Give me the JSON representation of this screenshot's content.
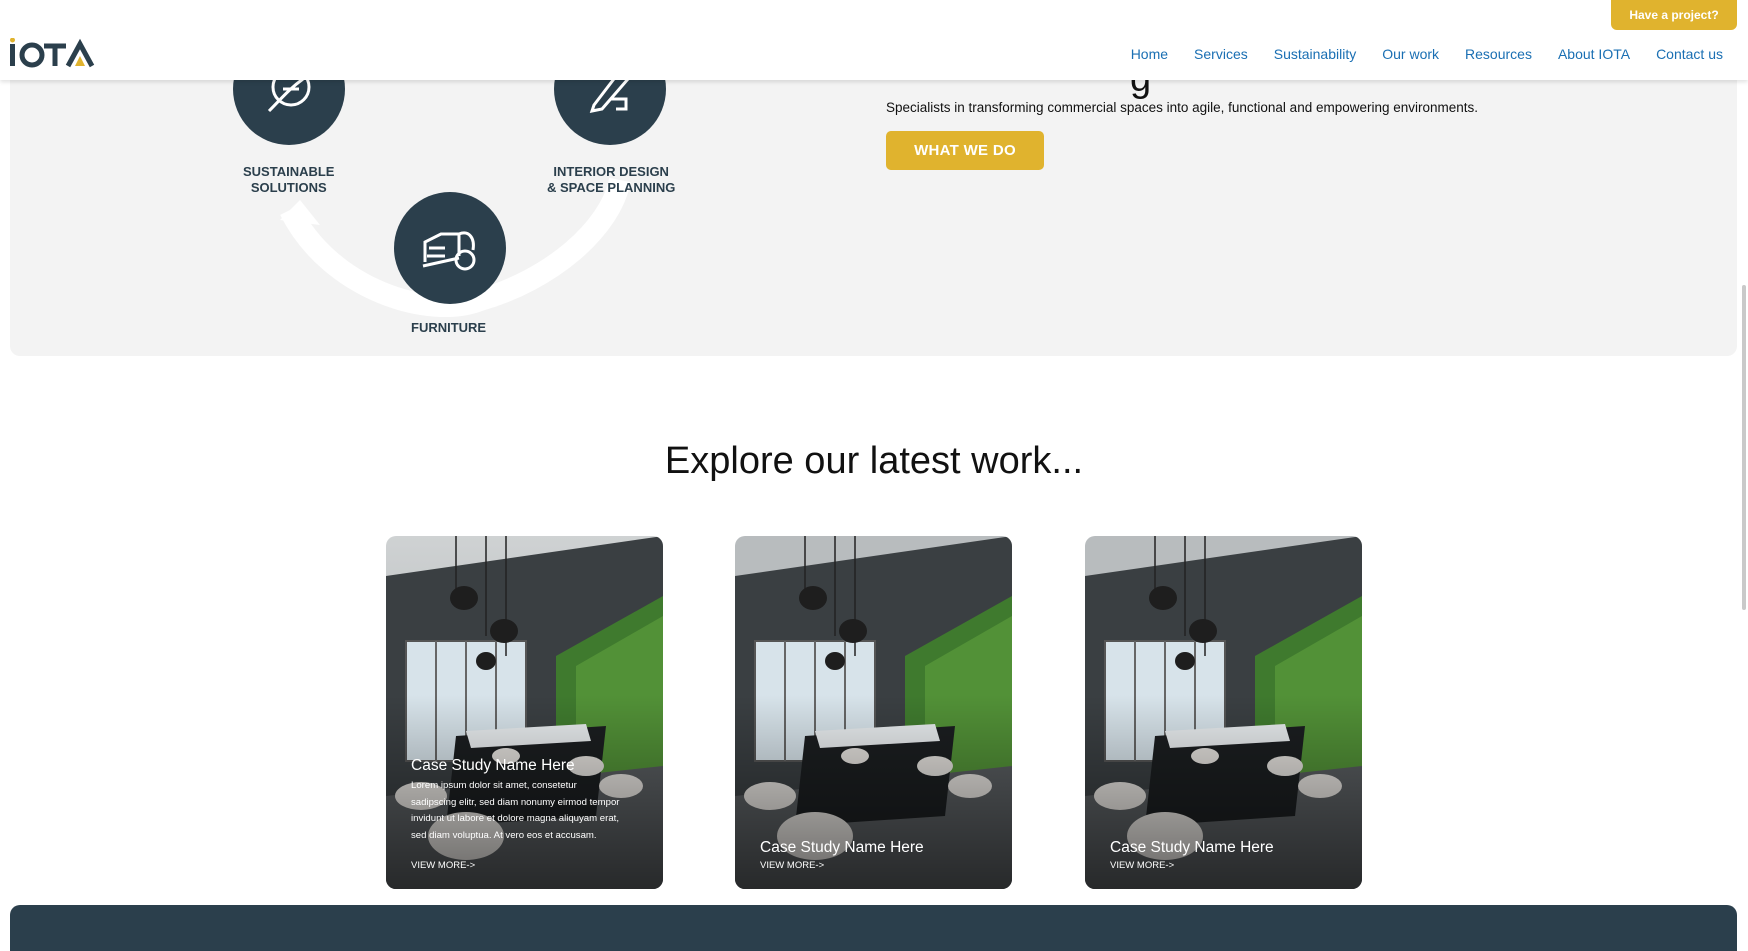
{
  "header": {
    "logo_text": "IOTA",
    "project_button": "Have a project?",
    "nav": [
      "Home",
      "Services",
      "Sustainability",
      "Our work",
      "Resources",
      "About IOTA",
      "Contact us"
    ]
  },
  "services": {
    "items": [
      {
        "label_line1": "SUSTAINABLE",
        "label_line2": "SOLUTIONS",
        "icon": "leaf-icon"
      },
      {
        "label_line1": "INTERIOR DESIGN",
        "label_line2": "& SPACE PLANNING",
        "icon": "pencil-ruler-icon"
      },
      {
        "label_line1": "FURNITURE",
        "label_line2": "",
        "icon": "sofa-icon"
      }
    ],
    "heading_fragment": "g",
    "intro": "Specialists in transforming commercial spaces into agile, functional and empowering environments.",
    "cta": "WHAT WE DO"
  },
  "work": {
    "title": "Explore our latest work...",
    "cards": [
      {
        "title": "Case Study Name Here",
        "description": "Lorem ipsum dolor sit amet, consetetur sadipscing elitr, sed diam nonumy eirmod tempor invidunt ut labore et dolore magna aliquyam erat, sed diam voluptua. At vero eos et accusam.",
        "more": "VIEW MORE->"
      },
      {
        "title": "Case Study Name Here",
        "description": "",
        "more": "VIEW MORE->"
      },
      {
        "title": "Case Study Name Here",
        "description": "",
        "more": "VIEW MORE->"
      }
    ]
  },
  "colors": {
    "accent": "#e0b32e",
    "navy": "#2b3f4c",
    "link": "#1a6fb3",
    "panel": "#f3f3f3"
  }
}
